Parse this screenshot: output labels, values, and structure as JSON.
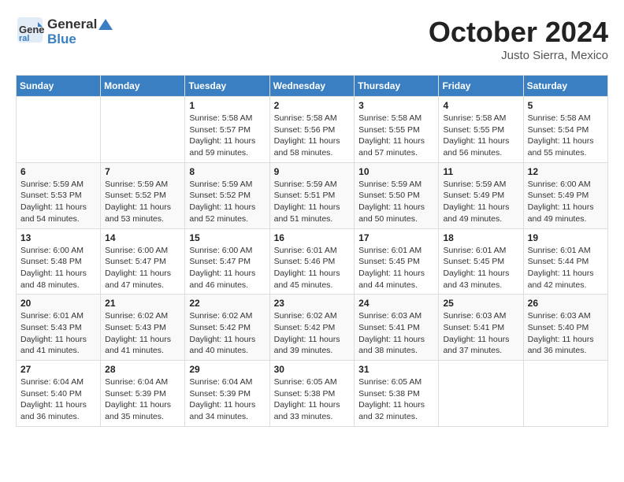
{
  "header": {
    "logo_general": "General",
    "logo_blue": "Blue",
    "title": "October 2024",
    "location": "Justo Sierra, Mexico"
  },
  "weekdays": [
    "Sunday",
    "Monday",
    "Tuesday",
    "Wednesday",
    "Thursday",
    "Friday",
    "Saturday"
  ],
  "weeks": [
    [
      {
        "day": "",
        "sunrise": "",
        "sunset": "",
        "daylight": ""
      },
      {
        "day": "",
        "sunrise": "",
        "sunset": "",
        "daylight": ""
      },
      {
        "day": "1",
        "sunrise": "Sunrise: 5:58 AM",
        "sunset": "Sunset: 5:57 PM",
        "daylight": "Daylight: 11 hours and 59 minutes."
      },
      {
        "day": "2",
        "sunrise": "Sunrise: 5:58 AM",
        "sunset": "Sunset: 5:56 PM",
        "daylight": "Daylight: 11 hours and 58 minutes."
      },
      {
        "day": "3",
        "sunrise": "Sunrise: 5:58 AM",
        "sunset": "Sunset: 5:55 PM",
        "daylight": "Daylight: 11 hours and 57 minutes."
      },
      {
        "day": "4",
        "sunrise": "Sunrise: 5:58 AM",
        "sunset": "Sunset: 5:55 PM",
        "daylight": "Daylight: 11 hours and 56 minutes."
      },
      {
        "day": "5",
        "sunrise": "Sunrise: 5:58 AM",
        "sunset": "Sunset: 5:54 PM",
        "daylight": "Daylight: 11 hours and 55 minutes."
      }
    ],
    [
      {
        "day": "6",
        "sunrise": "Sunrise: 5:59 AM",
        "sunset": "Sunset: 5:53 PM",
        "daylight": "Daylight: 11 hours and 54 minutes."
      },
      {
        "day": "7",
        "sunrise": "Sunrise: 5:59 AM",
        "sunset": "Sunset: 5:52 PM",
        "daylight": "Daylight: 11 hours and 53 minutes."
      },
      {
        "day": "8",
        "sunrise": "Sunrise: 5:59 AM",
        "sunset": "Sunset: 5:52 PM",
        "daylight": "Daylight: 11 hours and 52 minutes."
      },
      {
        "day": "9",
        "sunrise": "Sunrise: 5:59 AM",
        "sunset": "Sunset: 5:51 PM",
        "daylight": "Daylight: 11 hours and 51 minutes."
      },
      {
        "day": "10",
        "sunrise": "Sunrise: 5:59 AM",
        "sunset": "Sunset: 5:50 PM",
        "daylight": "Daylight: 11 hours and 50 minutes."
      },
      {
        "day": "11",
        "sunrise": "Sunrise: 5:59 AM",
        "sunset": "Sunset: 5:49 PM",
        "daylight": "Daylight: 11 hours and 49 minutes."
      },
      {
        "day": "12",
        "sunrise": "Sunrise: 6:00 AM",
        "sunset": "Sunset: 5:49 PM",
        "daylight": "Daylight: 11 hours and 49 minutes."
      }
    ],
    [
      {
        "day": "13",
        "sunrise": "Sunrise: 6:00 AM",
        "sunset": "Sunset: 5:48 PM",
        "daylight": "Daylight: 11 hours and 48 minutes."
      },
      {
        "day": "14",
        "sunrise": "Sunrise: 6:00 AM",
        "sunset": "Sunset: 5:47 PM",
        "daylight": "Daylight: 11 hours and 47 minutes."
      },
      {
        "day": "15",
        "sunrise": "Sunrise: 6:00 AM",
        "sunset": "Sunset: 5:47 PM",
        "daylight": "Daylight: 11 hours and 46 minutes."
      },
      {
        "day": "16",
        "sunrise": "Sunrise: 6:01 AM",
        "sunset": "Sunset: 5:46 PM",
        "daylight": "Daylight: 11 hours and 45 minutes."
      },
      {
        "day": "17",
        "sunrise": "Sunrise: 6:01 AM",
        "sunset": "Sunset: 5:45 PM",
        "daylight": "Daylight: 11 hours and 44 minutes."
      },
      {
        "day": "18",
        "sunrise": "Sunrise: 6:01 AM",
        "sunset": "Sunset: 5:45 PM",
        "daylight": "Daylight: 11 hours and 43 minutes."
      },
      {
        "day": "19",
        "sunrise": "Sunrise: 6:01 AM",
        "sunset": "Sunset: 5:44 PM",
        "daylight": "Daylight: 11 hours and 42 minutes."
      }
    ],
    [
      {
        "day": "20",
        "sunrise": "Sunrise: 6:01 AM",
        "sunset": "Sunset: 5:43 PM",
        "daylight": "Daylight: 11 hours and 41 minutes."
      },
      {
        "day": "21",
        "sunrise": "Sunrise: 6:02 AM",
        "sunset": "Sunset: 5:43 PM",
        "daylight": "Daylight: 11 hours and 41 minutes."
      },
      {
        "day": "22",
        "sunrise": "Sunrise: 6:02 AM",
        "sunset": "Sunset: 5:42 PM",
        "daylight": "Daylight: 11 hours and 40 minutes."
      },
      {
        "day": "23",
        "sunrise": "Sunrise: 6:02 AM",
        "sunset": "Sunset: 5:42 PM",
        "daylight": "Daylight: 11 hours and 39 minutes."
      },
      {
        "day": "24",
        "sunrise": "Sunrise: 6:03 AM",
        "sunset": "Sunset: 5:41 PM",
        "daylight": "Daylight: 11 hours and 38 minutes."
      },
      {
        "day": "25",
        "sunrise": "Sunrise: 6:03 AM",
        "sunset": "Sunset: 5:41 PM",
        "daylight": "Daylight: 11 hours and 37 minutes."
      },
      {
        "day": "26",
        "sunrise": "Sunrise: 6:03 AM",
        "sunset": "Sunset: 5:40 PM",
        "daylight": "Daylight: 11 hours and 36 minutes."
      }
    ],
    [
      {
        "day": "27",
        "sunrise": "Sunrise: 6:04 AM",
        "sunset": "Sunset: 5:40 PM",
        "daylight": "Daylight: 11 hours and 36 minutes."
      },
      {
        "day": "28",
        "sunrise": "Sunrise: 6:04 AM",
        "sunset": "Sunset: 5:39 PM",
        "daylight": "Daylight: 11 hours and 35 minutes."
      },
      {
        "day": "29",
        "sunrise": "Sunrise: 6:04 AM",
        "sunset": "Sunset: 5:39 PM",
        "daylight": "Daylight: 11 hours and 34 minutes."
      },
      {
        "day": "30",
        "sunrise": "Sunrise: 6:05 AM",
        "sunset": "Sunset: 5:38 PM",
        "daylight": "Daylight: 11 hours and 33 minutes."
      },
      {
        "day": "31",
        "sunrise": "Sunrise: 6:05 AM",
        "sunset": "Sunset: 5:38 PM",
        "daylight": "Daylight: 11 hours and 32 minutes."
      },
      {
        "day": "",
        "sunrise": "",
        "sunset": "",
        "daylight": ""
      },
      {
        "day": "",
        "sunrise": "",
        "sunset": "",
        "daylight": ""
      }
    ]
  ]
}
